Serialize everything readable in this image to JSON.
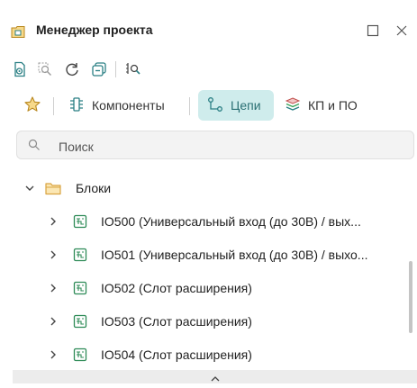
{
  "window": {
    "title": "Менеджер проекта"
  },
  "tabs": [
    {
      "label": "Компоненты"
    },
    {
      "label": "Цепи"
    },
    {
      "label": "КП и ПО"
    }
  ],
  "search": {
    "placeholder": "Поиск",
    "value": ""
  },
  "tree": {
    "root": {
      "label": "Блоки",
      "expanded": true
    },
    "items": [
      {
        "label": "IO500 (Универсальный вход (до 30В) / вых..."
      },
      {
        "label": "IO501 (Универсальный вход (до 30В) / выхо..."
      },
      {
        "label": "IO502 (Слот расширения)"
      },
      {
        "label": "IO503 (Слот расширения)"
      },
      {
        "label": "IO504 (Слот расширения)"
      }
    ]
  },
  "colors": {
    "accent": "#2a7f84",
    "active_tab_bg": "#cfecec",
    "folder": "#d9a441",
    "star": "#e0a93a"
  },
  "icons": [
    "project-manager-icon",
    "maximize-icon",
    "close-icon",
    "document-view-icon",
    "zoom-area-icon",
    "refresh-icon",
    "collapse-all-icon",
    "zoom-window-icon",
    "star-icon",
    "components-icon",
    "nets-icon",
    "layers-icon",
    "search-icon",
    "chevron-down-icon",
    "chevron-right-icon",
    "folder-icon",
    "block-icon",
    "chevron-up-icon"
  ]
}
